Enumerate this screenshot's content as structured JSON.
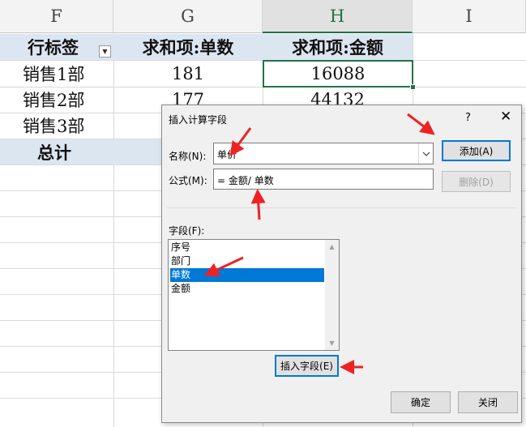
{
  "sheet": {
    "columns": [
      "F",
      "G",
      "H",
      "I"
    ],
    "active_column": "H",
    "pivot": {
      "headers": [
        "行标签",
        "求和项:单数",
        "求和项:金额"
      ],
      "rows": [
        {
          "label": "销售1部",
          "count": "181",
          "amount": "16088"
        },
        {
          "label": "销售2部",
          "count": "177",
          "amount": "44132"
        },
        {
          "label": "销售3部",
          "count": "",
          "amount": ""
        }
      ],
      "total_label": "总计"
    },
    "header_fill": "#dce6f1",
    "selection_color": "#217346"
  },
  "dialog": {
    "title": "插入计算字段",
    "help": "?",
    "close": "✕",
    "name_label": "名称(N):",
    "name_value": "单价",
    "formula_label": "公式(M):",
    "formula_value": "= 金额/ 单数",
    "add_button": "添加(A)",
    "delete_button": "删除(D)",
    "fields_label": "字段(F):",
    "fields": [
      "序号",
      "部门",
      "单数",
      "金额"
    ],
    "selected_field": "单数",
    "insert_field_button": "插入字段(E)",
    "ok_button": "确定",
    "close_button": "关闭",
    "accent": "#0078d7"
  },
  "annotations": {
    "arrow_color": "#ee2222"
  }
}
